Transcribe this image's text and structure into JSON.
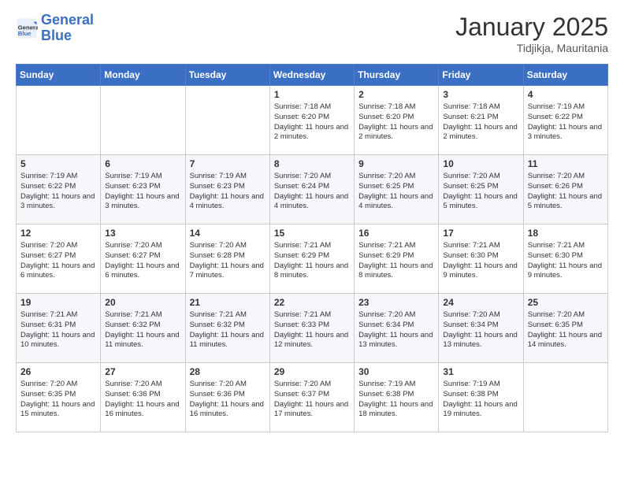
{
  "header": {
    "logo_general": "General",
    "logo_blue": "Blue",
    "month_title": "January 2025",
    "location": "Tidjikja, Mauritania"
  },
  "days_of_week": [
    "Sunday",
    "Monday",
    "Tuesday",
    "Wednesday",
    "Thursday",
    "Friday",
    "Saturday"
  ],
  "weeks": [
    [
      {
        "day": null
      },
      {
        "day": null
      },
      {
        "day": null
      },
      {
        "day": "1",
        "sunrise": "7:18 AM",
        "sunset": "6:20 PM",
        "daylight": "11 hours and 2 minutes."
      },
      {
        "day": "2",
        "sunrise": "7:18 AM",
        "sunset": "6:20 PM",
        "daylight": "11 hours and 2 minutes."
      },
      {
        "day": "3",
        "sunrise": "7:18 AM",
        "sunset": "6:21 PM",
        "daylight": "11 hours and 2 minutes."
      },
      {
        "day": "4",
        "sunrise": "7:19 AM",
        "sunset": "6:22 PM",
        "daylight": "11 hours and 3 minutes."
      }
    ],
    [
      {
        "day": "5",
        "sunrise": "7:19 AM",
        "sunset": "6:22 PM",
        "daylight": "11 hours and 3 minutes."
      },
      {
        "day": "6",
        "sunrise": "7:19 AM",
        "sunset": "6:23 PM",
        "daylight": "11 hours and 3 minutes."
      },
      {
        "day": "7",
        "sunrise": "7:19 AM",
        "sunset": "6:23 PM",
        "daylight": "11 hours and 4 minutes."
      },
      {
        "day": "8",
        "sunrise": "7:20 AM",
        "sunset": "6:24 PM",
        "daylight": "11 hours and 4 minutes."
      },
      {
        "day": "9",
        "sunrise": "7:20 AM",
        "sunset": "6:25 PM",
        "daylight": "11 hours and 4 minutes."
      },
      {
        "day": "10",
        "sunrise": "7:20 AM",
        "sunset": "6:25 PM",
        "daylight": "11 hours and 5 minutes."
      },
      {
        "day": "11",
        "sunrise": "7:20 AM",
        "sunset": "6:26 PM",
        "daylight": "11 hours and 5 minutes."
      }
    ],
    [
      {
        "day": "12",
        "sunrise": "7:20 AM",
        "sunset": "6:27 PM",
        "daylight": "11 hours and 6 minutes."
      },
      {
        "day": "13",
        "sunrise": "7:20 AM",
        "sunset": "6:27 PM",
        "daylight": "11 hours and 6 minutes."
      },
      {
        "day": "14",
        "sunrise": "7:20 AM",
        "sunset": "6:28 PM",
        "daylight": "11 hours and 7 minutes."
      },
      {
        "day": "15",
        "sunrise": "7:21 AM",
        "sunset": "6:29 PM",
        "daylight": "11 hours and 8 minutes."
      },
      {
        "day": "16",
        "sunrise": "7:21 AM",
        "sunset": "6:29 PM",
        "daylight": "11 hours and 8 minutes."
      },
      {
        "day": "17",
        "sunrise": "7:21 AM",
        "sunset": "6:30 PM",
        "daylight": "11 hours and 9 minutes."
      },
      {
        "day": "18",
        "sunrise": "7:21 AM",
        "sunset": "6:30 PM",
        "daylight": "11 hours and 9 minutes."
      }
    ],
    [
      {
        "day": "19",
        "sunrise": "7:21 AM",
        "sunset": "6:31 PM",
        "daylight": "11 hours and 10 minutes."
      },
      {
        "day": "20",
        "sunrise": "7:21 AM",
        "sunset": "6:32 PM",
        "daylight": "11 hours and 11 minutes."
      },
      {
        "day": "21",
        "sunrise": "7:21 AM",
        "sunset": "6:32 PM",
        "daylight": "11 hours and 11 minutes."
      },
      {
        "day": "22",
        "sunrise": "7:21 AM",
        "sunset": "6:33 PM",
        "daylight": "11 hours and 12 minutes."
      },
      {
        "day": "23",
        "sunrise": "7:20 AM",
        "sunset": "6:34 PM",
        "daylight": "11 hours and 13 minutes."
      },
      {
        "day": "24",
        "sunrise": "7:20 AM",
        "sunset": "6:34 PM",
        "daylight": "11 hours and 13 minutes."
      },
      {
        "day": "25",
        "sunrise": "7:20 AM",
        "sunset": "6:35 PM",
        "daylight": "11 hours and 14 minutes."
      }
    ],
    [
      {
        "day": "26",
        "sunrise": "7:20 AM",
        "sunset": "6:35 PM",
        "daylight": "11 hours and 15 minutes."
      },
      {
        "day": "27",
        "sunrise": "7:20 AM",
        "sunset": "6:36 PM",
        "daylight": "11 hours and 16 minutes."
      },
      {
        "day": "28",
        "sunrise": "7:20 AM",
        "sunset": "6:36 PM",
        "daylight": "11 hours and 16 minutes."
      },
      {
        "day": "29",
        "sunrise": "7:20 AM",
        "sunset": "6:37 PM",
        "daylight": "11 hours and 17 minutes."
      },
      {
        "day": "30",
        "sunrise": "7:19 AM",
        "sunset": "6:38 PM",
        "daylight": "11 hours and 18 minutes."
      },
      {
        "day": "31",
        "sunrise": "7:19 AM",
        "sunset": "6:38 PM",
        "daylight": "11 hours and 19 minutes."
      },
      {
        "day": null
      }
    ]
  ],
  "labels": {
    "sunrise_prefix": "Sunrise: ",
    "sunset_prefix": "Sunset: ",
    "daylight_prefix": "Daylight: "
  }
}
